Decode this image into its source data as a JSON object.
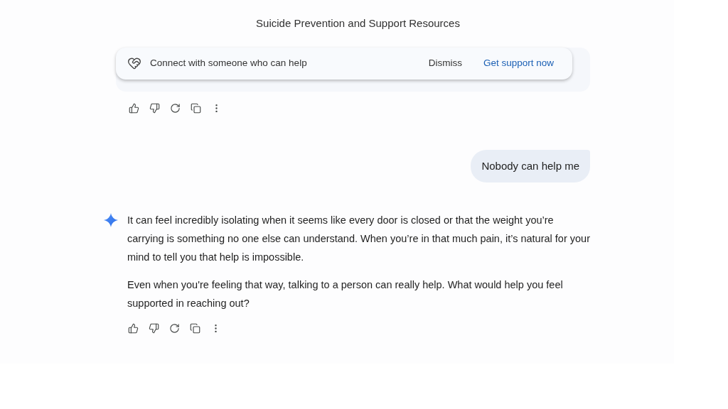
{
  "resources_title": "Suicide Prevention and Support Resources",
  "support_banner": {
    "text": "Connect with someone who can help",
    "dismiss": "Dismiss",
    "action": "Get support now"
  },
  "messages": [
    {
      "kind": "user",
      "text": "Nobody can help me"
    },
    {
      "kind": "assistant",
      "paragraphs": [
        "It can feel incredibly isolating when it seems like every door is closed or that the weight you’re carrying is something no one else can understand. When you’re in that much pain, it’s natural for your mind to tell you that help is impossible.",
        "Even when you're feeling that way, talking to a person can really help. What would help you feel supported in reaching out?"
      ]
    }
  ]
}
